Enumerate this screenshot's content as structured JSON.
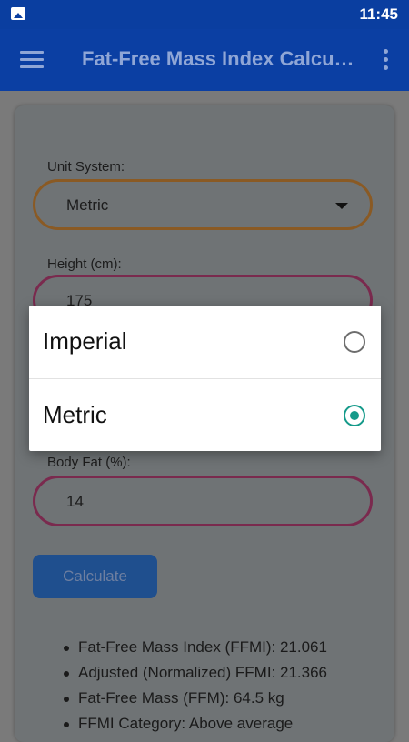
{
  "status_bar": {
    "time": "11:45",
    "notification_icon": "image-icon"
  },
  "app_bar": {
    "title": "Fat-Free Mass Index Calculator",
    "menu_icon": "hamburger-icon",
    "more_icon": "more-vert-icon"
  },
  "form": {
    "unit_label": "Unit System:",
    "unit_value": "Metric",
    "height_label": "Height (cm):",
    "height_value": "175",
    "bodyfat_label": "Body Fat (%):",
    "bodyfat_value": "14",
    "calculate_label": "Calculate"
  },
  "results": [
    "Fat-Free Mass Index (FFMI): 21.061",
    "Adjusted (Normalized) FFMI: 21.366",
    "Fat-Free Mass (FFM): 64.5 kg",
    "FFMI Category: Above average"
  ],
  "dialog": {
    "options": [
      {
        "label": "Imperial",
        "selected": false
      },
      {
        "label": "Metric",
        "selected": true
      }
    ]
  },
  "colors": {
    "primary": "#0b3fa3",
    "accent": "#159a8a"
  }
}
